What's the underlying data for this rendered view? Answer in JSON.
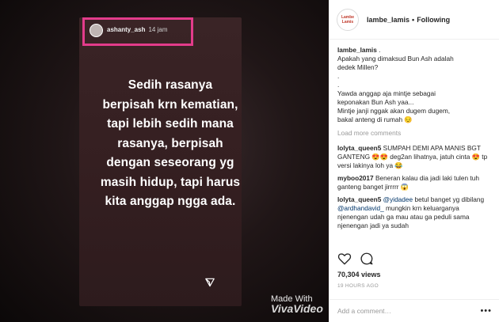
{
  "media": {
    "story_username": "ashanty_ash",
    "story_time": "14 jam",
    "story_text_lines": [
      "Sedih rasanya",
      "berpisah krn kematian,",
      "tapi lebih sedih mana",
      "rasanya, berpisah",
      "dengan seseorang yg",
      "masih hidup, tapi harus",
      "kita anggap ngga ada."
    ],
    "watermark_line1": "Made With",
    "watermark_line2": "VivaVideo"
  },
  "header": {
    "avatar_text": "Lambe Lamis",
    "username": "lambe_lamis",
    "separator": "•",
    "follow_status": "Following"
  },
  "caption": {
    "user": "lambe_lamis",
    "first": ".",
    "lines": [
      "Apakah yang dimaksud Bun Ash adalah",
      "dedek Millen?",
      ".",
      ".",
      "Yawda anggap aja mintje sebagai",
      "keponakan Bun Ash yaa...",
      "Mintje janji nggak akan dugem dugem,",
      "bakal anteng di rumah 😔"
    ]
  },
  "load_more": "Load more comments",
  "comments": [
    {
      "user": "lolyta_queen5",
      "text": "SUMPAH DEMI APA MANIS BGT GANTENG 😍😍 deg2an lihatnya, jatuh cinta 😍 tp versi lakinya loh ya 😂"
    },
    {
      "user": "myboo2017",
      "text": "Beneran kalau dia jadi laki tulen tuh ganteng banget jirrrrr 😱"
    },
    {
      "user": "lolyta_queen5",
      "mention1": "@yidadee",
      "text1": " betul banget yg dibilang ",
      "mention2": "@ardhandavid_",
      "text2": " mungkin krn keluarganya njenengan udah ga mau atau ga peduli sama njenengan jadi ya sudah"
    }
  ],
  "views": "70,304 views",
  "time_ago": "19 HOURS AGO",
  "add_comment_placeholder": "Add a comment…",
  "more_icon": "•••"
}
